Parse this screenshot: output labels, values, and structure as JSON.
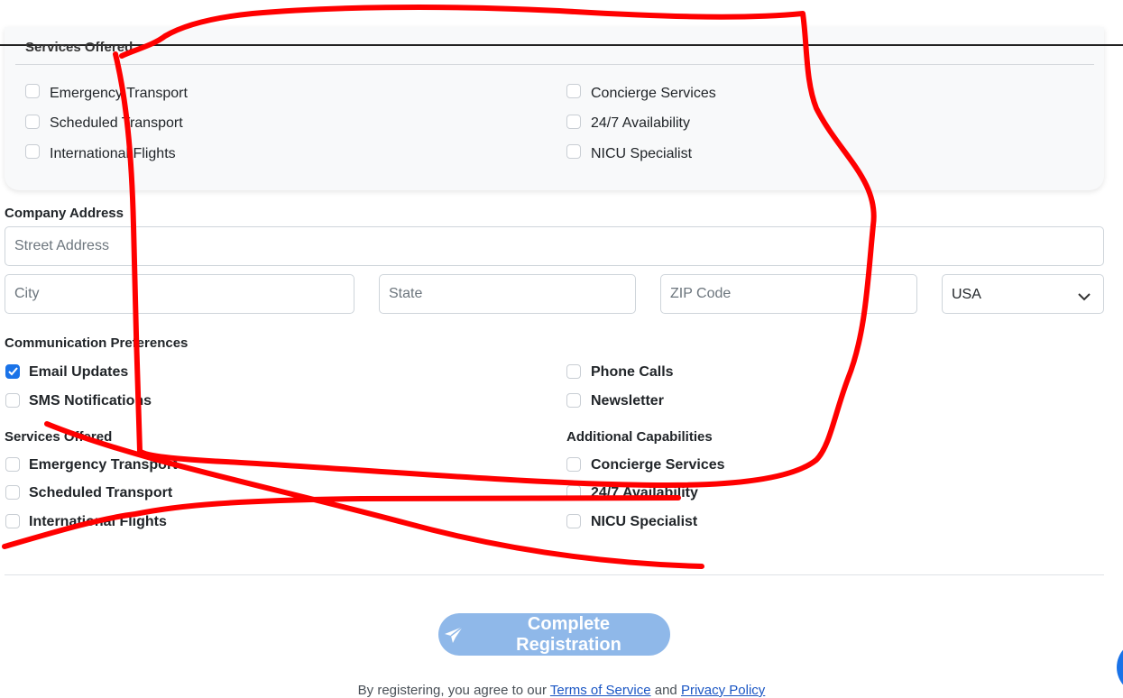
{
  "top_card": {
    "title": "Services Offered",
    "left_items": [
      "Emergency Transport",
      "Scheduled Transport",
      "International Flights"
    ],
    "right_items": [
      "Concierge Services",
      "24/7 Availability",
      "NICU Specialist"
    ]
  },
  "company_address": {
    "label": "Company Address",
    "street_placeholder": "Street Address",
    "city_placeholder": "City",
    "state_placeholder": "State",
    "zip_placeholder": "ZIP Code",
    "country_value": "USA"
  },
  "communication": {
    "label": "Communication Preferences",
    "email_updates": "Email Updates",
    "email_checked": true,
    "sms": "SMS Notifications",
    "phone_calls": "Phone Calls",
    "newsletter": "Newsletter"
  },
  "services": {
    "label": "Services Offered",
    "items": [
      "Emergency Transport",
      "Scheduled Transport",
      "International Flights"
    ]
  },
  "additional": {
    "label": "Additional Capabilities",
    "items": [
      "Concierge Services",
      "24/7 Availability",
      "NICU Specialist"
    ]
  },
  "submit": {
    "label": "Complete Registration",
    "icon": "paper-plane-icon"
  },
  "footer": {
    "prefix": "By registering, you agree to our",
    "terms": "Terms of Service",
    "and": "and",
    "privacy": "Privacy Policy"
  },
  "colors": {
    "accent": "#1a73e8",
    "button_disabled": "#8fb8e9",
    "annotation": "#ff0000"
  }
}
